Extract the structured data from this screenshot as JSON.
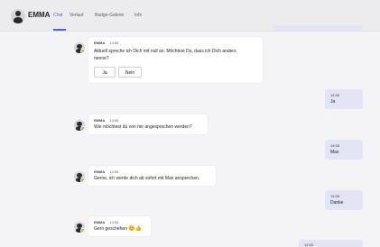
{
  "app": {
    "title": "EMMA",
    "tabs": [
      "Chat",
      "Verlauf",
      "Badge-Galerie",
      "Info"
    ]
  },
  "colors": {
    "accent": "#5b5fc7",
    "user_bubble": "#e3e4f4",
    "bot_bubble": "#ffffff",
    "status_online": "#92c353"
  },
  "icons": {
    "app_avatar": "bot-avatar-icon",
    "bot_avatar": "bot-avatar-icon",
    "status": "online-status-icon"
  },
  "messages": [
    {
      "from": "bot",
      "sender": "EMMA",
      "time": "14:55",
      "lines": [
        "Aktuell spreche ich Dich mit null an. Möchtest Du, dass ich Dich anders",
        "nenne?"
      ],
      "buttons": [
        "Ja",
        "Nein"
      ]
    },
    {
      "from": "user",
      "time": "14:55",
      "text": "Ja"
    },
    {
      "from": "bot",
      "sender": "EMMA",
      "time": "14:55",
      "lines": [
        "Wie möchtest du von mir angesprochen werden?"
      ]
    },
    {
      "from": "user",
      "time": "14:55",
      "text": "Max"
    },
    {
      "from": "bot",
      "sender": "EMMA",
      "time": "14:55",
      "lines": [
        "Gerne, ich werde dich ab sofort mit Max ansprechen."
      ]
    },
    {
      "from": "user",
      "time": "14:55",
      "text": "Danke"
    },
    {
      "from": "bot",
      "sender": "EMMA",
      "time": "14:55",
      "lines": [
        "Gern geschehen"
      ],
      "emoji": "😊👍"
    },
    {
      "from": "user",
      "time": "14:55",
      "text": ""
    }
  ]
}
